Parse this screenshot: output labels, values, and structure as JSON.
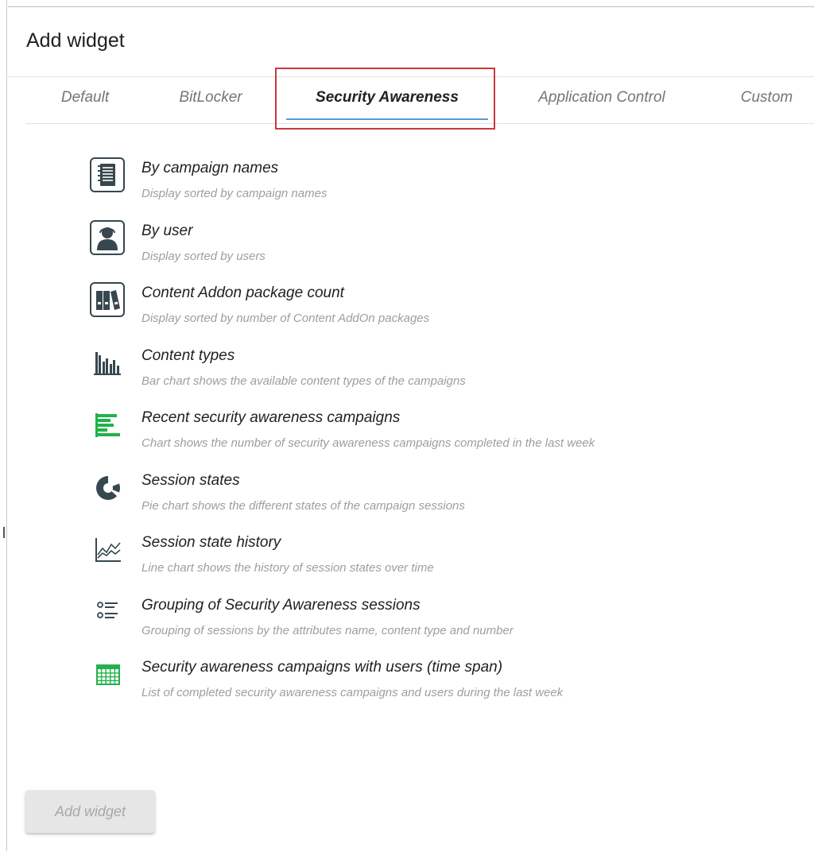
{
  "dialog": {
    "title": "Add widget"
  },
  "tabs": [
    {
      "label": "Default",
      "active": false
    },
    {
      "label": "BitLocker",
      "active": false
    },
    {
      "label": "Security Awareness",
      "active": true
    },
    {
      "label": "Application Control",
      "active": false
    },
    {
      "label": "Custom",
      "active": false
    }
  ],
  "widgets": [
    {
      "icon": "list-document-icon",
      "title": "By campaign names",
      "description": "Display sorted by campaign names"
    },
    {
      "icon": "user-icon",
      "title": "By user",
      "description": "Display sorted by users"
    },
    {
      "icon": "binders-icon",
      "title": "Content Addon package count",
      "description": "Display sorted by number of Content AddOn packages"
    },
    {
      "icon": "bar-chart-icon",
      "title": "Content types",
      "description": "Bar chart shows the available content types of the campaigns"
    },
    {
      "icon": "horizontal-bar-chart-icon",
      "title": "Recent security awareness campaigns",
      "description": "Chart shows the number of security awareness campaigns completed in the last week"
    },
    {
      "icon": "donut-chart-icon",
      "title": "Session states",
      "description": "Pie chart shows the different states of the campaign sessions"
    },
    {
      "icon": "line-chart-icon",
      "title": "Session state history",
      "description": "Line chart shows the history of session states over time"
    },
    {
      "icon": "grouping-list-icon",
      "title": "Grouping of Security Awareness sessions",
      "description": "Grouping of sessions by the attributes name, content type and number"
    },
    {
      "icon": "table-grid-icon",
      "title": "Security awareness campaigns with users (time span)",
      "description": "List of completed security awareness campaigns and users during the last week"
    }
  ],
  "footer": {
    "add_button_label": "Add widget",
    "add_button_enabled": false
  },
  "colors": {
    "active_tab_underline": "#5b9bd5",
    "highlight_box": "#c9393d",
    "icon_dark": "#37474f",
    "icon_green": "#21b24b",
    "disabled_button_bg": "#e6e6e6"
  }
}
